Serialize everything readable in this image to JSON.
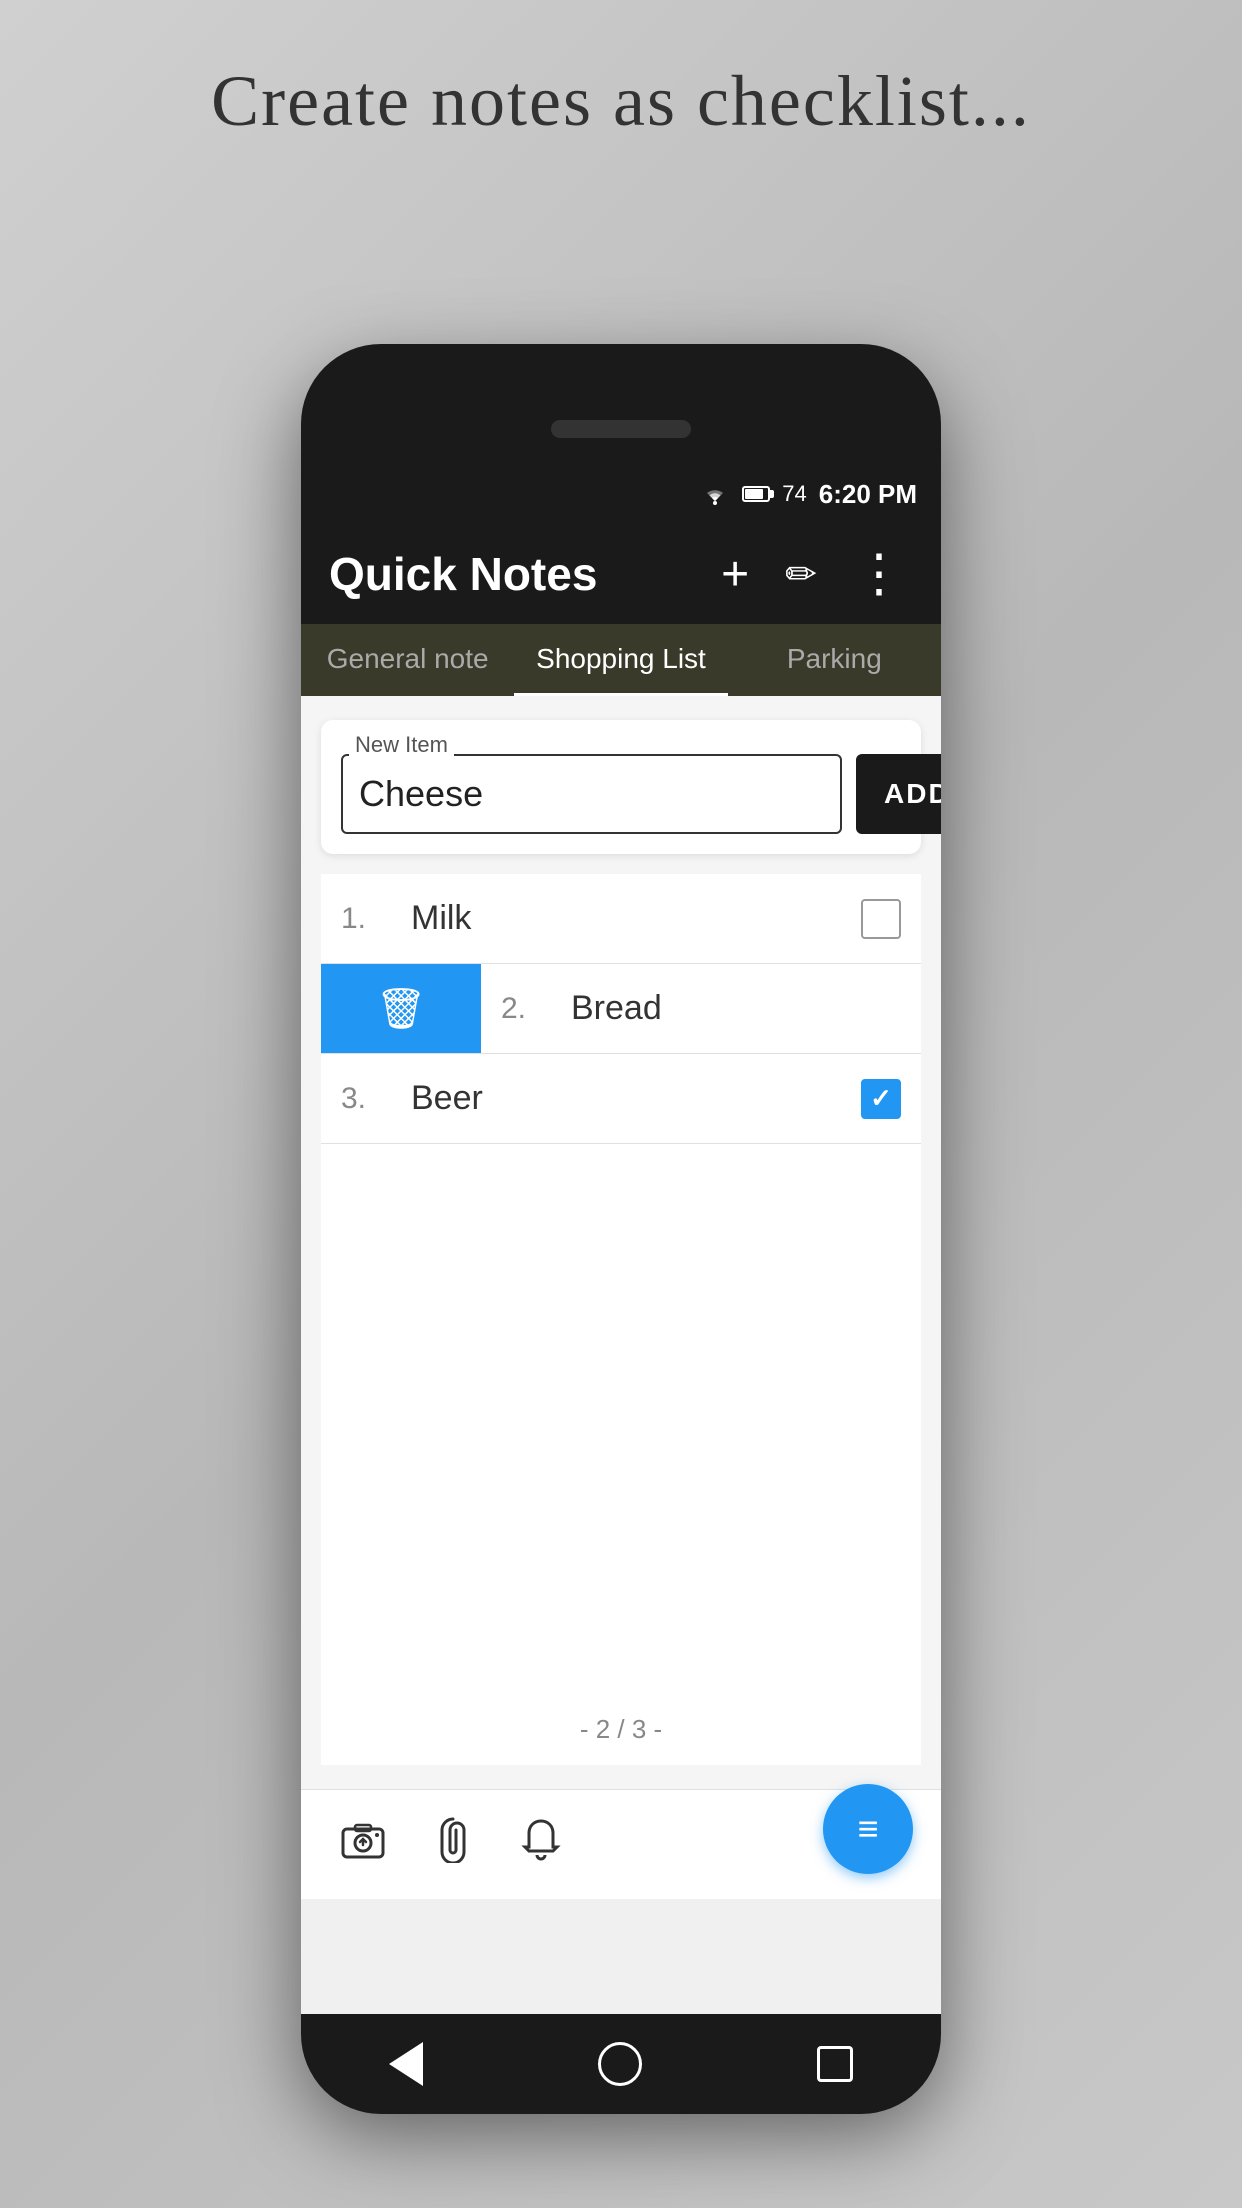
{
  "page": {
    "background_title": "Create notes as checklist..."
  },
  "status_bar": {
    "time": "6:20 PM",
    "battery_percent": "74"
  },
  "app_bar": {
    "title": "Quick Notes",
    "add_icon": "+",
    "edit_icon": "✏",
    "more_icon": "⋮"
  },
  "tabs": [
    {
      "label": "General note",
      "active": false
    },
    {
      "label": "Shopping List",
      "active": true
    },
    {
      "label": "Parking",
      "active": false
    }
  ],
  "new_item_section": {
    "label": "New Item",
    "input_value": "Cheese",
    "add_button_label": "ADD"
  },
  "list_items": [
    {
      "number": "1.",
      "text": "Milk",
      "checked": false,
      "swipe_delete": false
    },
    {
      "number": "2.",
      "text": "Bread",
      "checked": false,
      "swipe_delete": true
    },
    {
      "number": "3.",
      "text": "Beer",
      "checked": true,
      "swipe_delete": false
    }
  ],
  "pagination": {
    "text": "- 2 / 3 -"
  },
  "bottom_toolbar": {
    "camera_icon": "📷",
    "attach_icon": "📎",
    "bell_icon": "🔔"
  },
  "nav_bar": {
    "back_label": "back",
    "home_label": "home",
    "recent_label": "recent"
  },
  "fab": {
    "icon": "≡"
  }
}
